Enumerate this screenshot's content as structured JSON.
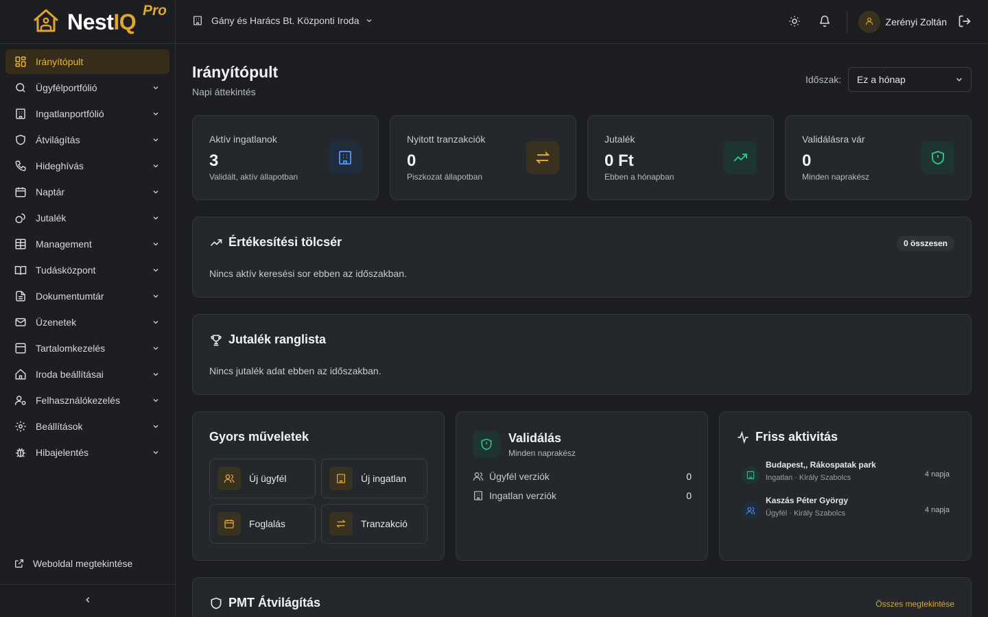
{
  "brand": {
    "name_part1": "Nest",
    "name_part2": "IQ",
    "edition": "Pro"
  },
  "sidebar": {
    "items": [
      {
        "label": "Irányítópult",
        "icon": "layout-grid-icon",
        "active": true
      },
      {
        "label": "Ügyfélportfólió",
        "icon": "search-icon"
      },
      {
        "label": "Ingatlanportfólió",
        "icon": "building-icon"
      },
      {
        "label": "Átvilágítás",
        "icon": "shield-icon"
      },
      {
        "label": "Hideghívás",
        "icon": "phone-icon"
      },
      {
        "label": "Naptár",
        "icon": "calendar-icon"
      },
      {
        "label": "Jutalék",
        "icon": "coins-icon"
      },
      {
        "label": "Management",
        "icon": "table-icon"
      },
      {
        "label": "Tudásközpont",
        "icon": "book-open-icon"
      },
      {
        "label": "Dokumentumtár",
        "icon": "file-text-icon"
      },
      {
        "label": "Üzenetek",
        "icon": "mail-icon"
      },
      {
        "label": "Tartalomkezelés",
        "icon": "panel-icon"
      },
      {
        "label": "Iroda beállításai",
        "icon": "home-icon"
      },
      {
        "label": "Felhasználókezelés",
        "icon": "user-cog-icon"
      },
      {
        "label": "Beállítások",
        "icon": "gear-icon"
      },
      {
        "label": "Hibajelentés",
        "icon": "bug-icon"
      }
    ],
    "website_link": "Weboldal megtekintése"
  },
  "topbar": {
    "office": "Gány és Harács Bt. Központi Iroda",
    "user": "Zerényi Zoltán"
  },
  "page": {
    "title": "Irányítópult",
    "subtitle": "Napi áttekintés",
    "period_label": "Időszak:",
    "period_value": "Ez a hónap"
  },
  "stats": [
    {
      "label": "Aktív ingatlanok",
      "value": "3",
      "desc": "Validált, aktív állapotban",
      "icon": "building-icon",
      "color": "#4f8fe8"
    },
    {
      "label": "Nyitott tranzakciók",
      "value": "0",
      "desc": "Piszkozat állapotban",
      "icon": "arrows-swap-icon",
      "color": "#e0a72c"
    },
    {
      "label": "Jutalék",
      "value": "0 Ft",
      "desc": "Ebben a hónapban",
      "icon": "trending-up-icon",
      "color": "#2fc08a"
    },
    {
      "label": "Validálásra vár",
      "value": "0",
      "desc": "Minden naprakész",
      "icon": "shield-alert-icon",
      "color": "#2fc08a"
    }
  ],
  "funnel": {
    "title": "Értékesítési tölcsér",
    "badge": "0 összesen",
    "empty": "Nincs aktív keresési sor ebben az időszakban."
  },
  "leaderboard": {
    "title": "Jutalék ranglista",
    "empty": "Nincs jutalék adat ebben az időszakban."
  },
  "quick_actions": {
    "title": "Gyors műveletek",
    "items": [
      {
        "label": "Új ügyfél",
        "icon": "users-icon"
      },
      {
        "label": "Új ingatlan",
        "icon": "building-icon"
      },
      {
        "label": "Foglalás",
        "icon": "calendar-icon"
      },
      {
        "label": "Tranzakció",
        "icon": "arrows-swap-icon"
      }
    ]
  },
  "validation": {
    "title": "Validálás",
    "subtitle": "Minden naprakész",
    "rows": [
      {
        "label": "Ügyfél verziók",
        "count": "0",
        "icon": "users-icon"
      },
      {
        "label": "Ingatlan verziók",
        "count": "0",
        "icon": "building-icon"
      }
    ]
  },
  "activity": {
    "title": "Friss aktivitás",
    "items": [
      {
        "title": "Budapest,, Rákospatak park",
        "sub": "Ingatlan · Király Szabolcs",
        "date": "4 napja",
        "icon": "building-icon",
        "color": "#2fc08a"
      },
      {
        "title": "Kaszás Péter György",
        "sub": "Ügyfél · Király Szabolcs",
        "date": "4 napja",
        "icon": "users-icon",
        "color": "#4f8fe8"
      }
    ]
  },
  "pmt": {
    "title": "PMT Átvilágítás",
    "link": "Összes megtekintése"
  }
}
